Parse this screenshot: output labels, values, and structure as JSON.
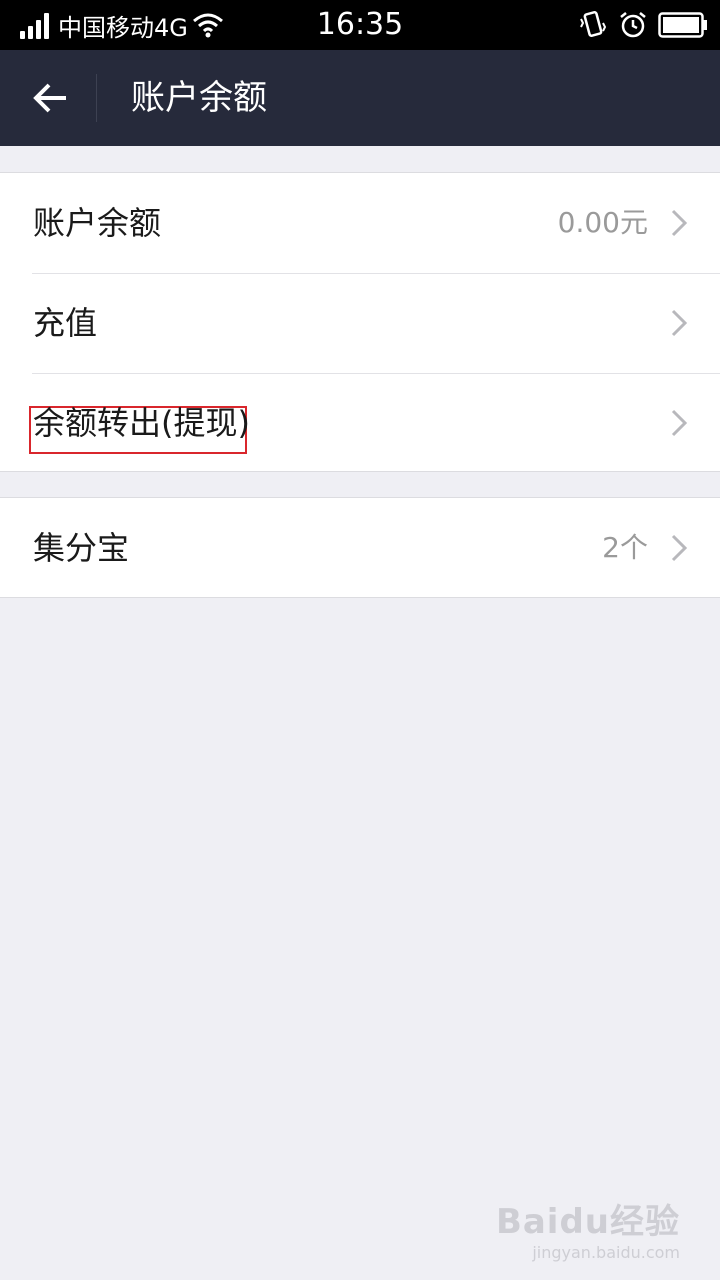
{
  "status_bar": {
    "carrier": "中国移动4G",
    "time": "16:35",
    "icons": [
      "signal-icon",
      "wifi-icon",
      "vibrate-icon",
      "alarm-icon",
      "battery-icon"
    ]
  },
  "header": {
    "back_icon": "arrow-left-icon",
    "title": "账户余额"
  },
  "groups": [
    {
      "items": [
        {
          "label": "账户余额",
          "value": "0.00元"
        },
        {
          "label": "充值",
          "value": ""
        },
        {
          "label": "余额转出(提现)",
          "value": "",
          "highlighted": true
        }
      ]
    },
    {
      "items": [
        {
          "label": "集分宝",
          "value": "2个"
        }
      ]
    }
  ],
  "watermark": {
    "logo": "Baidu经验",
    "url": "jingyan.baidu.com"
  },
  "colors": {
    "status_bar_bg": "#000000",
    "header_bg": "#262a3b",
    "page_bg": "#efeff4",
    "highlight": "#d9262c"
  }
}
